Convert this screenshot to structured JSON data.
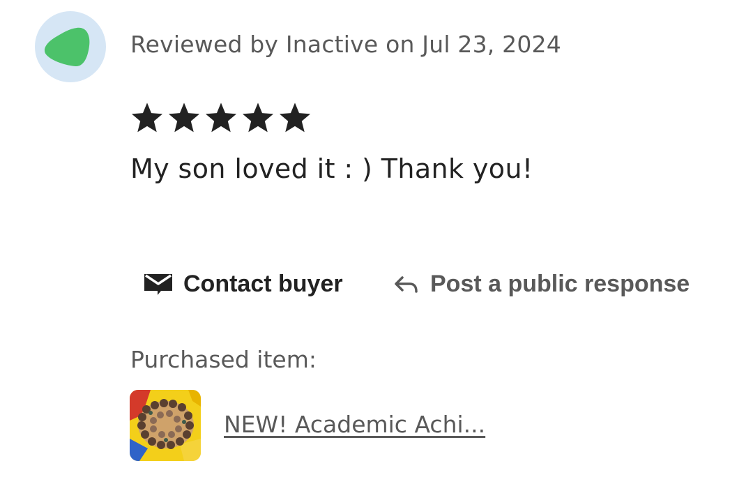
{
  "review": {
    "meta": "Reviewed by Inactive on Jul 23, 2024",
    "rating": 5,
    "rating_max": 5,
    "text": "My son loved it : ) Thank you!"
  },
  "avatar": {
    "icon": "green-blob-avatar",
    "background_color": "#d6e6f5",
    "shape_color": "#4cc26a"
  },
  "actions": {
    "contact_label": "Contact buyer",
    "contact_icon": "envelope-icon",
    "respond_label": "Post a public response",
    "respond_icon": "reply-arrow-icon"
  },
  "purchase": {
    "label": "Purchased item:",
    "item_title": "NEW! Academic Achi...",
    "thumbnail_icon": "product-thumbnail-beads"
  },
  "colors": {
    "star": "#222222",
    "primary_text": "#222222",
    "secondary_text": "#595959"
  }
}
